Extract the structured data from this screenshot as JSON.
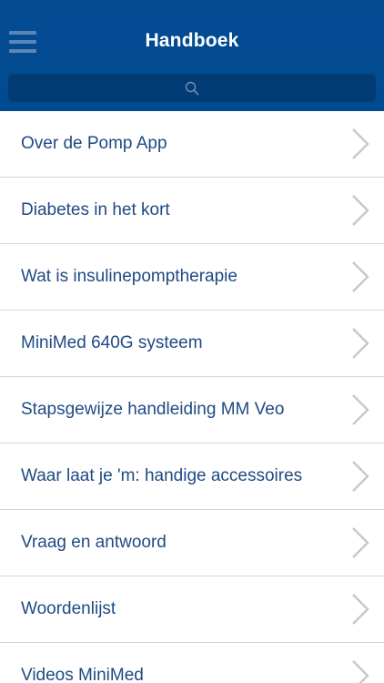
{
  "header": {
    "title": "Handboek",
    "menu_icon": "hamburger-menu-icon"
  },
  "search": {
    "placeholder": "",
    "value": "",
    "icon": "search-icon"
  },
  "colors": {
    "header_bg": "#044b93",
    "search_bg": "#033b74",
    "row_text": "#1f4a83",
    "chevron": "#c7c7cc",
    "divider": "#d6d6d8"
  },
  "menu": {
    "items": [
      {
        "label": "Over de Pomp App"
      },
      {
        "label": "Diabetes in het kort"
      },
      {
        "label": "Wat is insulinepomptherapie"
      },
      {
        "label": "MiniMed 640G systeem"
      },
      {
        "label": "Stapsgewijze handleiding MM Veo"
      },
      {
        "label": "Waar laat je 'm: handige accessoires"
      },
      {
        "label": "Vraag en antwoord"
      },
      {
        "label": "Woordenlijst"
      },
      {
        "label": "Videos MiniMed"
      }
    ]
  }
}
